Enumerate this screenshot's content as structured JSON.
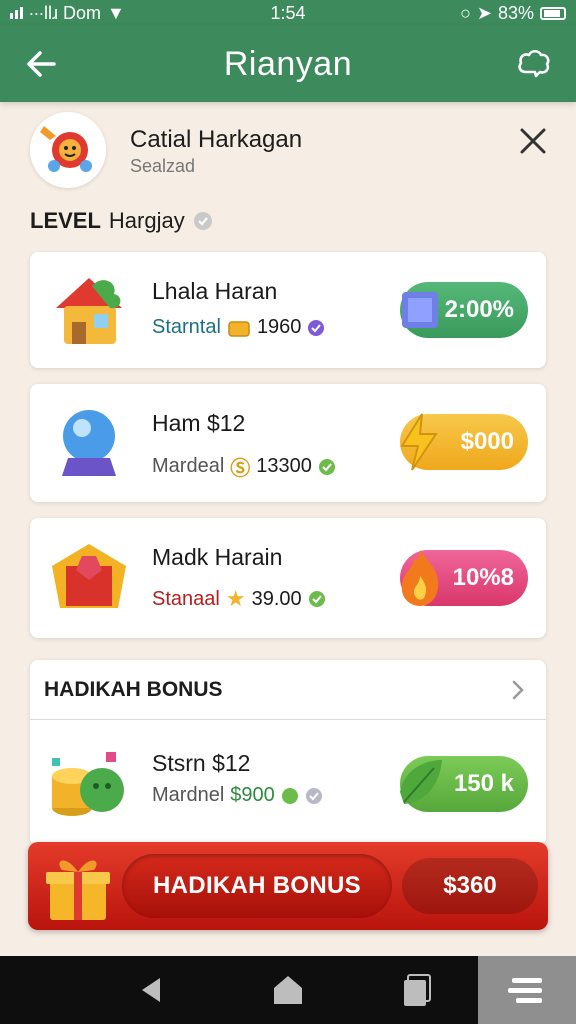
{
  "status_bar": {
    "carrier": "∙∙∙llɹ Dom",
    "time": "1:54",
    "battery": "83%"
  },
  "header": {
    "title": "Rianyan"
  },
  "profile": {
    "name": "Catial Harkagan",
    "subtitle": "Sealzad"
  },
  "level": {
    "prefix": "LEVEL",
    "name": "Hargjay"
  },
  "offers": [
    {
      "title": "Lhala Haran",
      "sub_label": "Starntal",
      "sub_value": "1960",
      "price": "2:00%",
      "chip_color": "#46a768",
      "label_color": "#1b6f8a"
    },
    {
      "title": "Ham $12",
      "sub_label": "Mardeal",
      "sub_value": "13300",
      "price": "$000",
      "chip_color": "#f2b32a",
      "label_color": "#555555"
    },
    {
      "title": "Madk Harain",
      "sub_label": "Stanaal",
      "sub_value": "39.00",
      "price": "10%8",
      "chip_color": "#e6497a",
      "label_color": "#b3201c"
    }
  ],
  "bonus_section": {
    "title": "HADIKAH BONUS",
    "item": {
      "title": "Stsrn $12",
      "sub_label": "Mardnel",
      "sub_value": "$900",
      "price": "150 k",
      "chip_color": "#6cbb4b"
    }
  },
  "bonus_bar": {
    "label": "HADIKAH BONUS",
    "price": "$360"
  },
  "icons": [
    "back-arrow-icon",
    "chat-icon",
    "close-icon",
    "check-badge-icon",
    "house-icon",
    "crystal-ball-icon",
    "gift-box-icon",
    "coin-stack-icon",
    "chevron-right-icon",
    "lightning-icon",
    "fire-icon",
    "leaf-icon",
    "gem-icon",
    "gold-bar-icon",
    "star-icon"
  ]
}
